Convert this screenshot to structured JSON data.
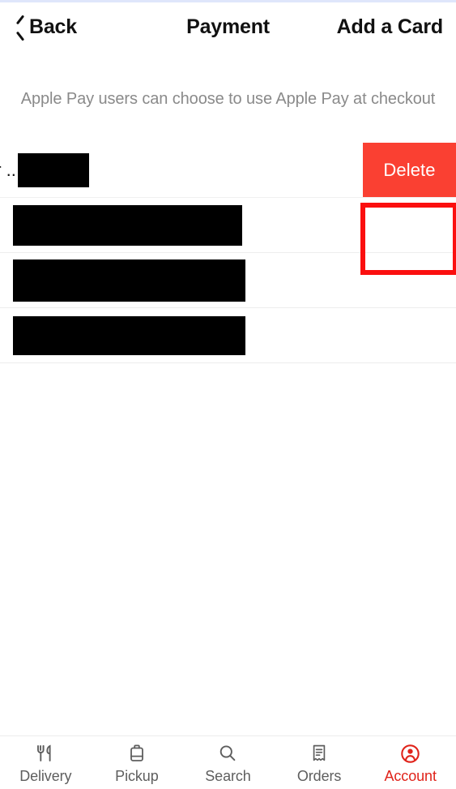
{
  "navbar": {
    "back_label": "Back",
    "back_icon": "chevron-left-icon",
    "title": "Payment",
    "action_label": "Add a Card"
  },
  "content": {
    "info_note": "Apple Pay users can choose to use Apple Pay at checkout",
    "rows": [
      {
        "truncated_text": "er ..",
        "redacted": true,
        "swiped_open": true,
        "delete_label": "Delete"
      },
      {
        "truncated_text": "",
        "redacted": true,
        "swiped_open": false
      },
      {
        "truncated_text": "",
        "redacted": true,
        "swiped_open": false
      },
      {
        "truncated_text": "",
        "redacted": true,
        "swiped_open": false
      }
    ]
  },
  "annotation": {
    "target": "delete-button",
    "border_color": "#fb0f0f"
  },
  "tabbar": {
    "items": [
      {
        "label": "Delivery",
        "icon": "cutlery-icon",
        "active": false
      },
      {
        "label": "Pickup",
        "icon": "takeout-bag-icon",
        "active": false
      },
      {
        "label": "Search",
        "icon": "search-icon",
        "active": false
      },
      {
        "label": "Orders",
        "icon": "receipt-icon",
        "active": false
      },
      {
        "label": "Account",
        "icon": "account-circle-icon",
        "active": true
      }
    ]
  },
  "colors": {
    "accent_red": "#e0231a",
    "delete_red": "#fa4032",
    "annotation_red": "#fb0f0f",
    "muted_text": "#8a8a8a",
    "separator": "#ededed"
  }
}
